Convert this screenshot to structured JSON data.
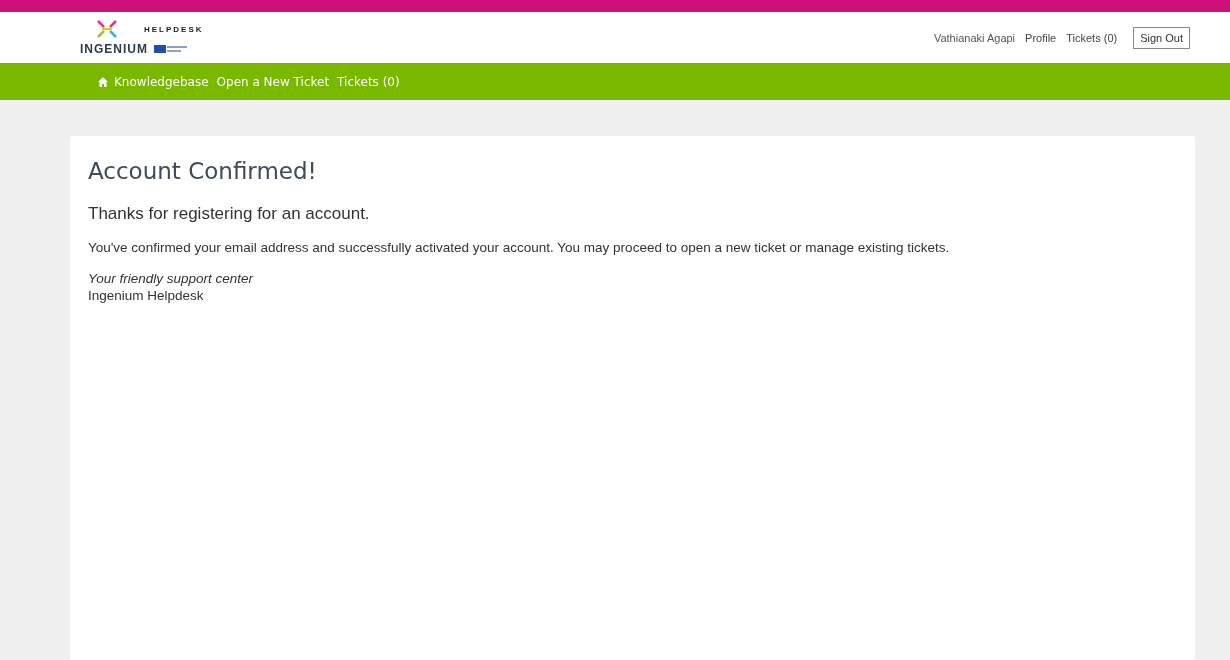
{
  "header": {
    "logo_name": "INGENIUM",
    "logo_subtitle": "HELPDESK",
    "user_links": [
      {
        "kind": "text",
        "label": "Vathianaki Agapi"
      },
      {
        "kind": "link",
        "label": "Profile"
      },
      {
        "kind": "link",
        "label": "Tickets (0)"
      },
      {
        "kind": "button",
        "label": "Sign Out"
      }
    ]
  },
  "nav": {
    "items": [
      {
        "label": "Knowledgebase",
        "kind": "home"
      },
      {
        "label": "Open a New Ticket"
      },
      {
        "label": "Tickets (0)"
      }
    ]
  },
  "content": {
    "title": "Account Confirmed!",
    "subtitle": "Thanks for registering for an account.",
    "message": "You've confirmed your email address and successfully activated your account. You may proceed to open a new ticket or manage existing tickets.",
    "signature_line": "Your friendly support center",
    "signature_name": "Ingenium Helpdesk"
  }
}
